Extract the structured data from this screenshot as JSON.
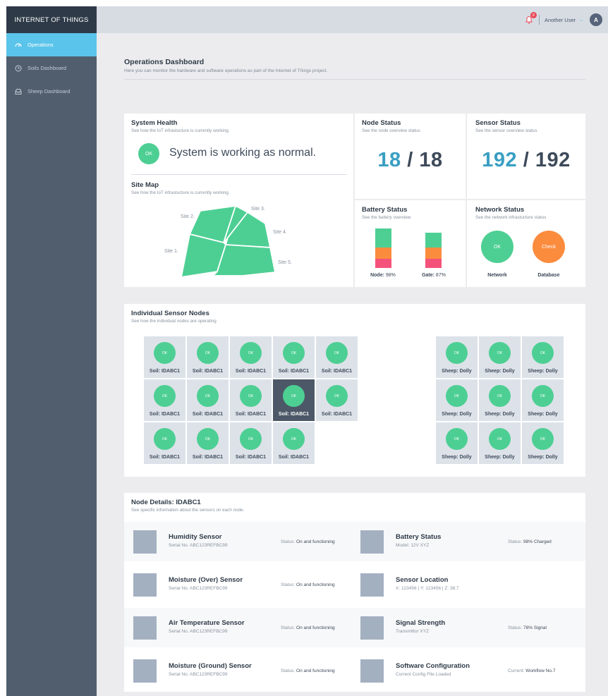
{
  "app": {
    "brand": "INTERNET OF THINGS"
  },
  "sidebar": {
    "items": [
      {
        "label": "Operations",
        "icon": "dashboard-icon",
        "active": true
      },
      {
        "label": "Soils Dashboard",
        "icon": "clock-icon",
        "active": false
      },
      {
        "label": "Sheep Dashboard",
        "icon": "inbox-icon",
        "active": false
      }
    ]
  },
  "topbar": {
    "notification_count": "8",
    "user_name": "Another User",
    "avatar_initial": "A"
  },
  "page": {
    "title": "Operations Dashboard",
    "subtitle": "Here you can monitor the hardware and software operations as part of the Internet of Things project."
  },
  "system_health": {
    "title": "System Health",
    "subtitle": "See how the IoT infrastucture is currently working.",
    "badge": "OK",
    "message": "System is working as normal."
  },
  "site_map": {
    "title": "Site Map",
    "subtitle": "See how the IoT infrastucture is currently working.",
    "sites": [
      "Site 1.",
      "Site 2.",
      "Site 3.",
      "Site 4.",
      "Site 5."
    ]
  },
  "node_status": {
    "title": "Node Status",
    "subtitle": "See the node overview status",
    "active": "18",
    "slash": "/",
    "total": "18"
  },
  "sensor_status": {
    "title": "Sensor Status",
    "subtitle": "See the sensor overview status",
    "active": "192",
    "slash": "/",
    "total": "192"
  },
  "battery_status": {
    "title": "Battery Status",
    "subtitle": "See the battery overview",
    "bars": [
      {
        "label": "Node:",
        "value": "98%",
        "level": 0.98
      },
      {
        "label": "Gate:",
        "value": "87%",
        "level": 0.87
      }
    ]
  },
  "network_status": {
    "title": "Network Status",
    "subtitle": "See the network infrastucture status",
    "items": [
      {
        "badge": "OK",
        "label": "Network",
        "color": "#4dcf93"
      },
      {
        "badge": "Check",
        "label": "Database",
        "color": "#fb8c3e"
      }
    ]
  },
  "sensor_nodes": {
    "title": "Individual Sensor Nodes",
    "subtitle": "See how the individual nodes are operating",
    "soil_nodes": [
      {
        "badge": "OK",
        "label": "Soil: IDABC1"
      },
      {
        "badge": "OK",
        "label": "Soil: IDABC1"
      },
      {
        "badge": "OK",
        "label": "Soil: IDABC1"
      },
      {
        "badge": "OK",
        "label": "Soil: IDABC1"
      },
      {
        "badge": "OK",
        "label": "Soil: IDABC1"
      },
      {
        "badge": "OK",
        "label": "Soil: IDABC1"
      },
      {
        "badge": "OK",
        "label": "Soil: IDABC1"
      },
      {
        "badge": "OK",
        "label": "Soil: IDABC1"
      },
      {
        "badge": "OK",
        "label": "Soil: IDABC1",
        "selected": true
      },
      {
        "badge": "OK",
        "label": "Soil: IDABC1"
      },
      {
        "badge": "OK",
        "label": "Soil: IDABC1"
      },
      {
        "badge": "OK",
        "label": "Soil: IDABC1"
      },
      {
        "badge": "OK",
        "label": "Soil: IDABC1"
      },
      {
        "badge": "OK",
        "label": "Soil: IDABC1"
      }
    ],
    "sheep_nodes": [
      {
        "badge": "OK",
        "label": "Sheep: Dolly"
      },
      {
        "badge": "OK",
        "label": "Sheep: Dolly"
      },
      {
        "badge": "OK",
        "label": "Sheep: Dolly"
      },
      {
        "badge": "OK",
        "label": "Sheep: Dolly"
      },
      {
        "badge": "OK",
        "label": "Sheep: Dolly"
      },
      {
        "badge": "OK",
        "label": "Sheep: Dolly"
      },
      {
        "badge": "OK",
        "label": "Sheep: Dolly"
      },
      {
        "badge": "OK",
        "label": "Sheep: Dolly"
      },
      {
        "badge": "OK",
        "label": "Sheep: Dolly"
      }
    ]
  },
  "node_details": {
    "title": "Node Details: IDABC1",
    "subtitle": "See specific information about the sensors on each node.",
    "rows": [
      {
        "left": {
          "name": "Humidity Sensor",
          "sub": "Serial No. ABC123REFBC99",
          "status_key": "Status:",
          "status_val": "On and functioning"
        },
        "right": {
          "name": "Battery Status",
          "sub": "Model: 12V XYZ",
          "status_key": "Status:",
          "status_val": "98% Charged"
        }
      },
      {
        "left": {
          "name": "Moisture (Over) Sensor",
          "sub": "Serial No. ABC123REFBC99",
          "status_key": "Status:",
          "status_val": "On and functioning"
        },
        "right": {
          "name": "Sensor Location",
          "sub": "X: 123456 | Y: 123456 | Z: 38.7",
          "status_key": "",
          "status_val": ""
        }
      },
      {
        "left": {
          "name": "Air Temperature Sensor",
          "sub": "Serial No. ABC123REFBC99",
          "status_key": "Status:",
          "status_val": "On and functioning"
        },
        "right": {
          "name": "Signal Strength",
          "sub": "Transmittor XYZ",
          "status_key": "Status:",
          "status_val": "78% Signal"
        }
      },
      {
        "left": {
          "name": "Moisture (Ground) Sensor",
          "sub": "Serial No. ABC123REFBC99",
          "status_key": "Status:",
          "status_val": "On and functioning"
        },
        "right": {
          "name": "Software Configuration",
          "sub": "Current Config FIle Loaded",
          "status_key": "Current:",
          "status_val": "Workflow No.7"
        }
      }
    ]
  },
  "colors": {
    "accent": "#5bc4ea",
    "ok": "#4dcf93",
    "warn": "#fb8c3e",
    "danger": "#f4527a",
    "sidebar": "#505e6e"
  }
}
